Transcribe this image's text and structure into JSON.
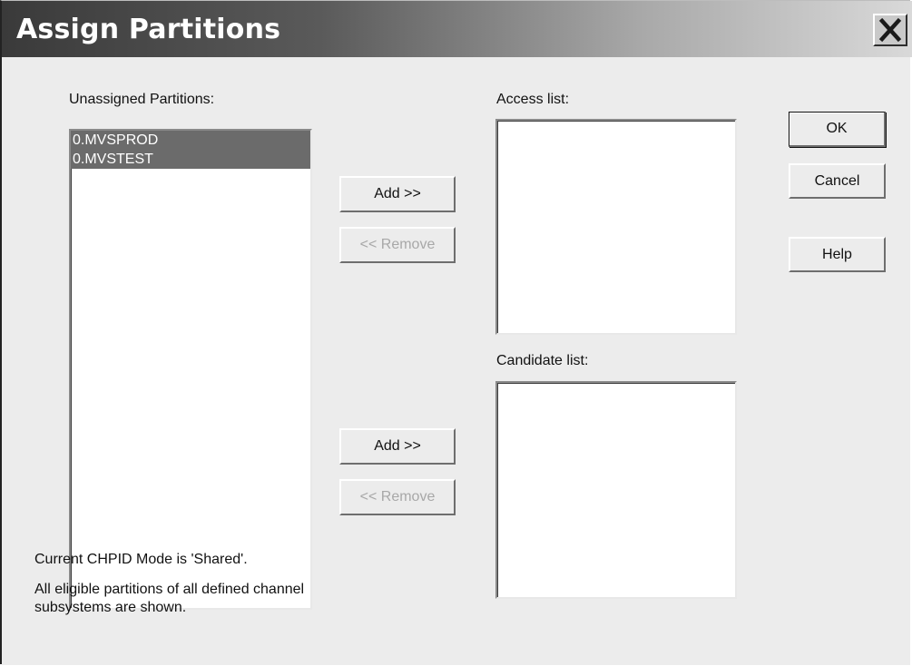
{
  "window": {
    "title": "Assign Partitions"
  },
  "unassigned": {
    "label": "Unassigned Partitions:",
    "items": [
      "0.MVSPROD",
      "0.MVSTEST"
    ]
  },
  "access": {
    "label": "Access list:",
    "items": []
  },
  "candidate": {
    "label": "Candidate list:",
    "items": []
  },
  "buttons": {
    "add_access": "Add >>",
    "remove_access": "<< Remove",
    "add_candidate": "Add >>",
    "remove_candidate": "<< Remove",
    "ok": "OK",
    "cancel": "Cancel",
    "help": "Help"
  },
  "info": {
    "mode": "Current CHPID Mode is 'Shared'.",
    "line1": "All eligible partitions of all defined channel",
    "line2": "subsystems are shown."
  },
  "colors": {
    "selection": "#6b6b6b",
    "titlebar_dark": "#3a3a3a",
    "dialog_bg": "#ececec"
  },
  "icons": {
    "close": "close-icon"
  }
}
